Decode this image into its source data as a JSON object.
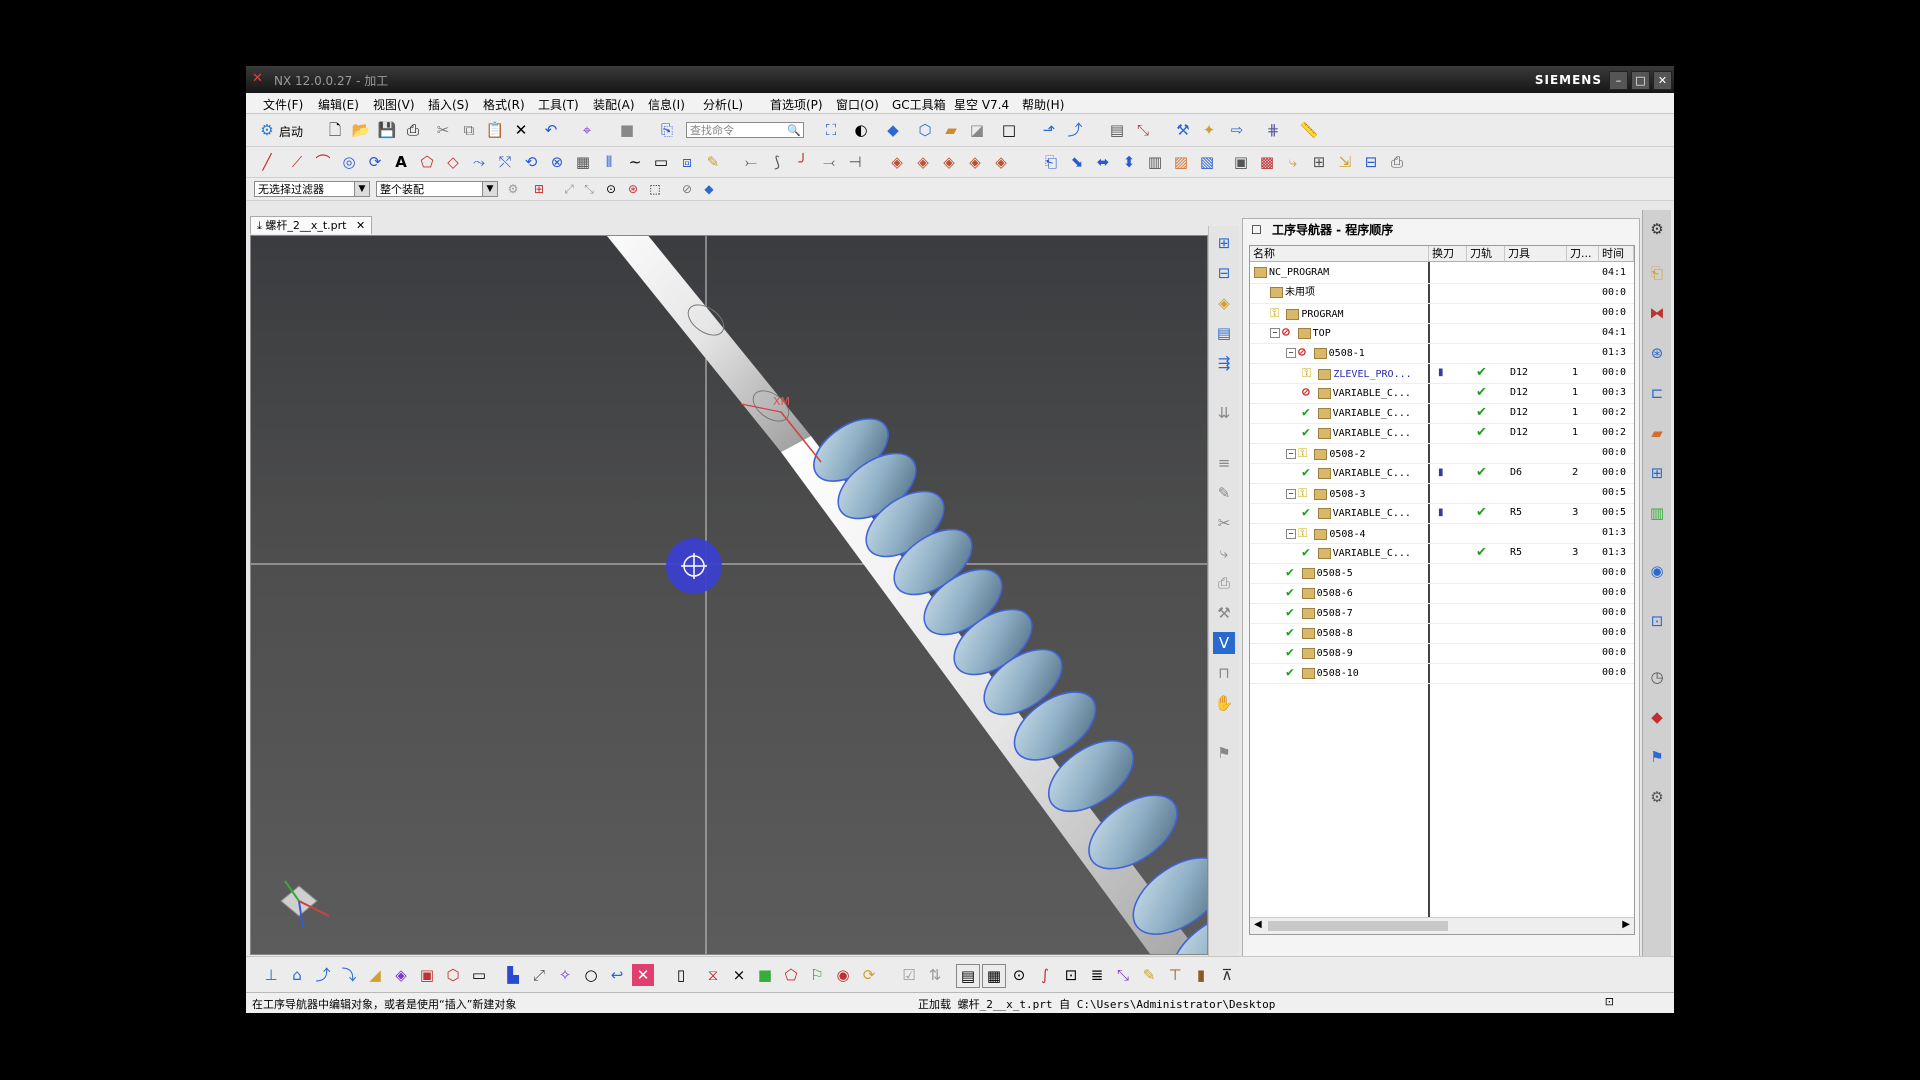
{
  "window": {
    "title": "NX 12.0.0.27 - 加工",
    "brand": "SIEMENS",
    "controls": [
      "–",
      "□",
      "✕"
    ]
  },
  "menubar": [
    "文件(F)",
    "编辑(E)",
    "视图(V)",
    "插入(S)",
    "格式(R)",
    "工具(T)",
    "装配(A)",
    "信息(I)",
    "分析(L)",
    "首选项(P)",
    "窗口(O)",
    "GC工具箱",
    "星空 V7.4",
    "帮助(H)"
  ],
  "toolbar1": {
    "start_label": "启动",
    "search_placeholder": "查找命令"
  },
  "selection_bar": {
    "filter_value": "无选择过滤器",
    "scope_value": "整个装配"
  },
  "document_tab": {
    "label": "螺杆_2__x_t.prt"
  },
  "viewport": {
    "wcs_label": "XM"
  },
  "navigator": {
    "title": "工序导航器 - 程序顺序",
    "columns": [
      "名称",
      "换刀",
      "刀轨",
      "刀具",
      "刀...",
      "时间"
    ],
    "rows": [
      {
        "name": "NC_PROGRAM",
        "level": 0,
        "status": "none",
        "toggle": "",
        "tool_change": false,
        "path": false,
        "tool": "",
        "tool_no": "",
        "time": "04:1"
      },
      {
        "name": "未用项",
        "level": 1,
        "status": "none",
        "toggle": "",
        "tool_change": false,
        "path": false,
        "tool": "",
        "tool_no": "",
        "time": "00:0"
      },
      {
        "name": "PROGRAM",
        "level": 1,
        "status": "key",
        "toggle": "",
        "tool_change": false,
        "path": false,
        "tool": "",
        "tool_no": "",
        "time": "00:0"
      },
      {
        "name": "TOP",
        "level": 1,
        "status": "noent",
        "toggle": "−",
        "tool_change": false,
        "path": false,
        "tool": "",
        "tool_no": "",
        "time": "04:1"
      },
      {
        "name": "0508-1",
        "level": 2,
        "status": "noent",
        "toggle": "−",
        "tool_change": false,
        "path": false,
        "tool": "",
        "tool_no": "",
        "time": "01:3"
      },
      {
        "name": "ZLEVEL_PRO...",
        "level": 3,
        "status": "key",
        "toggle": "",
        "tool_change": true,
        "path": true,
        "tool": "D12",
        "tool_no": "1",
        "time": "00:0"
      },
      {
        "name": "VARIABLE_C...",
        "level": 3,
        "status": "noent",
        "toggle": "",
        "tool_change": false,
        "path": true,
        "tool": "D12",
        "tool_no": "1",
        "time": "00:3"
      },
      {
        "name": "VARIABLE_C...",
        "level": 3,
        "status": "chk",
        "toggle": "",
        "tool_change": false,
        "path": true,
        "tool": "D12",
        "tool_no": "1",
        "time": "00:2"
      },
      {
        "name": "VARIABLE_C...",
        "level": 3,
        "status": "chk",
        "toggle": "",
        "tool_change": false,
        "path": true,
        "tool": "D12",
        "tool_no": "1",
        "time": "00:2"
      },
      {
        "name": "0508-2",
        "level": 2,
        "status": "key",
        "toggle": "−",
        "tool_change": false,
        "path": false,
        "tool": "",
        "tool_no": "",
        "time": "00:0"
      },
      {
        "name": "VARIABLE_C...",
        "level": 3,
        "status": "chk",
        "toggle": "",
        "tool_change": true,
        "path": true,
        "tool": "D6",
        "tool_no": "2",
        "time": "00:0"
      },
      {
        "name": "0508-3",
        "level": 2,
        "status": "key",
        "toggle": "−",
        "tool_change": false,
        "path": false,
        "tool": "",
        "tool_no": "",
        "time": "00:5"
      },
      {
        "name": "VARIABLE_C...",
        "level": 3,
        "status": "chk",
        "toggle": "",
        "tool_change": true,
        "path": true,
        "tool": "R5",
        "tool_no": "3",
        "time": "00:5"
      },
      {
        "name": "0508-4",
        "level": 2,
        "status": "key",
        "toggle": "−",
        "tool_change": false,
        "path": false,
        "tool": "",
        "tool_no": "",
        "time": "01:3"
      },
      {
        "name": "VARIABLE_C...",
        "level": 3,
        "status": "chk",
        "toggle": "",
        "tool_change": false,
        "path": true,
        "tool": "R5",
        "tool_no": "3",
        "time": "01:3"
      },
      {
        "name": "0508-5",
        "level": 2,
        "status": "chk",
        "toggle": "",
        "tool_change": false,
        "path": false,
        "tool": "",
        "tool_no": "",
        "time": "00:0"
      },
      {
        "name": "0508-6",
        "level": 2,
        "status": "chk",
        "toggle": "",
        "tool_change": false,
        "path": false,
        "tool": "",
        "tool_no": "",
        "time": "00:0"
      },
      {
        "name": "0508-7",
        "level": 2,
        "status": "chk",
        "toggle": "",
        "tool_change": false,
        "path": false,
        "tool": "",
        "tool_no": "",
        "time": "00:0"
      },
      {
        "name": "0508-8",
        "level": 2,
        "status": "chk",
        "toggle": "",
        "tool_change": false,
        "path": false,
        "tool": "",
        "tool_no": "",
        "time": "00:0"
      },
      {
        "name": "0508-9",
        "level": 2,
        "status": "chk",
        "toggle": "",
        "tool_change": false,
        "path": false,
        "tool": "",
        "tool_no": "",
        "time": "00:0"
      },
      {
        "name": "0508-10",
        "level": 2,
        "status": "chk",
        "toggle": "",
        "tool_change": false,
        "path": false,
        "tool": "",
        "tool_no": "",
        "time": "00:0"
      }
    ]
  },
  "statusbar": {
    "hint": "在工序导航器中编辑对象，或者是使用“插入”新建对象",
    "loading": "正加载 螺杆_2__x_t.prt 自 C:\\Users\\Administrator\\Desktop"
  },
  "colors": {
    "titlebar": "#1f1f1f",
    "check_green": "#1aa31a",
    "noentry_red": "#d32020",
    "highlight_blue": "#3f63d8"
  }
}
